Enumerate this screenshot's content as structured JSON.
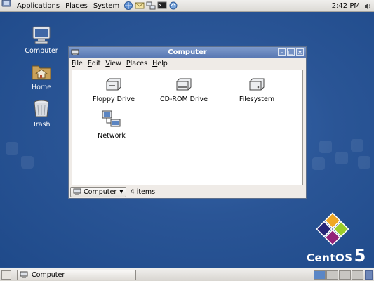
{
  "top_panel": {
    "menus": [
      "Applications",
      "Places",
      "System"
    ],
    "launchers": [
      "browser-icon",
      "mail-icon",
      "network-icon",
      "terminal-icon",
      "notes-icon"
    ],
    "clock": "2:42 PM",
    "volume_icon": "volume-icon"
  },
  "desktop": {
    "icons": [
      {
        "label": "Computer",
        "icon": "computer-icon"
      },
      {
        "label": "Home",
        "icon": "home-folder-icon"
      },
      {
        "label": "Trash",
        "icon": "trash-icon"
      }
    ],
    "brand": {
      "text": "CentOS",
      "version": "5"
    }
  },
  "window": {
    "title": "Computer",
    "menu": [
      "File",
      "Edit",
      "View",
      "Places",
      "Help"
    ],
    "items": [
      {
        "label": "Floppy Drive",
        "icon": "floppy-drive-icon"
      },
      {
        "label": "CD-ROM Drive",
        "icon": "cdrom-drive-icon"
      },
      {
        "label": "Filesystem",
        "icon": "filesystem-icon"
      },
      {
        "label": "Network",
        "icon": "network-icon"
      }
    ],
    "location": "Computer",
    "item_count": "4 items"
  },
  "bottom_panel": {
    "task_label": "Computer",
    "workspaces": 4,
    "active_workspace": 1
  },
  "colors": {
    "desktop": "#24508f",
    "titlebar": "#5978b3",
    "panel": "#e6e4e0"
  }
}
